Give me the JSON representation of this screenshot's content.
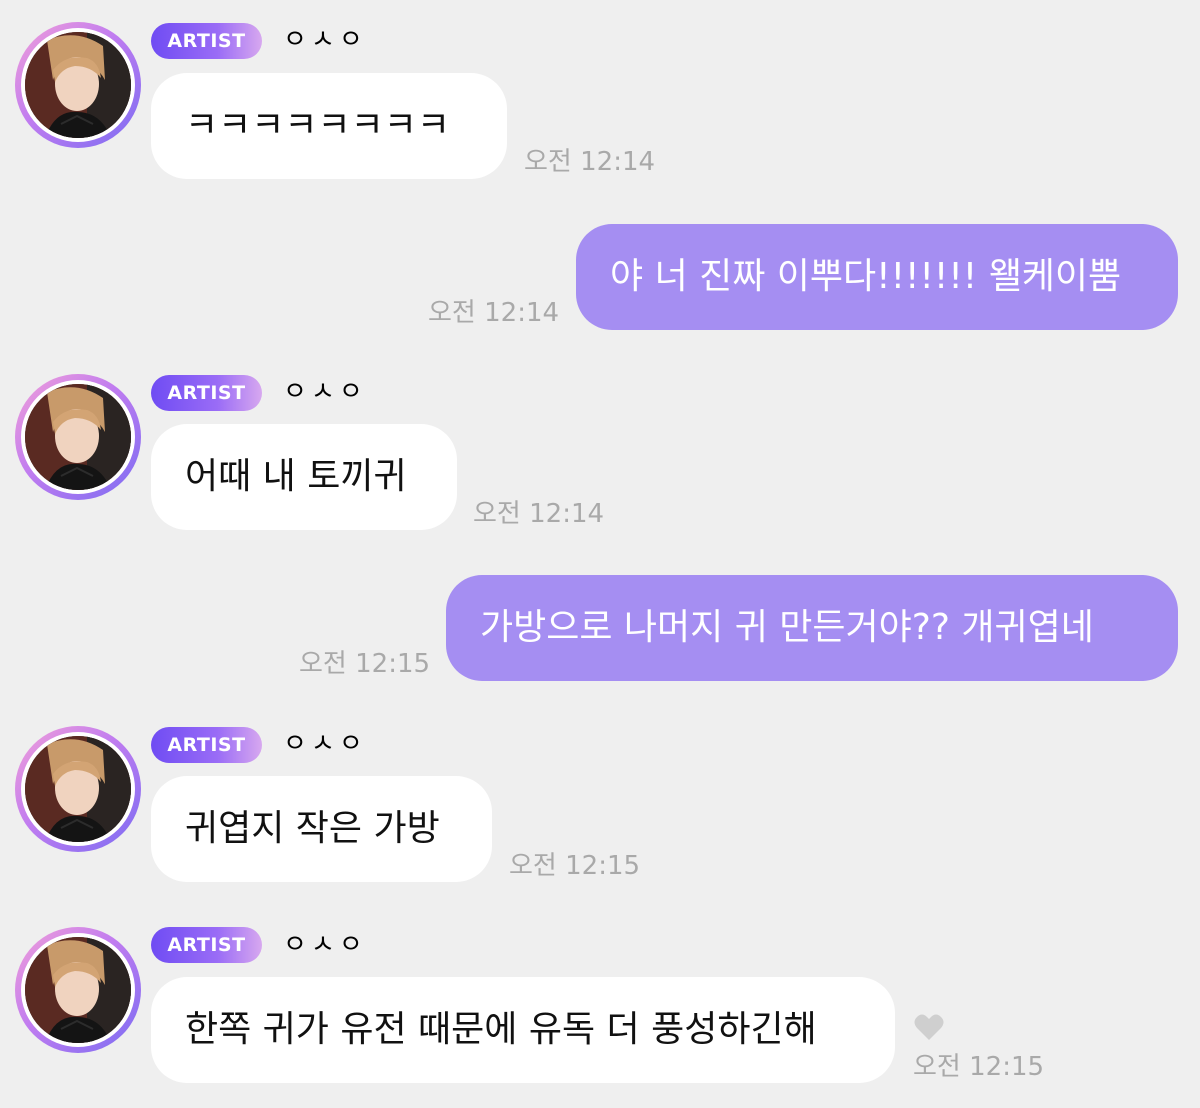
{
  "conversation": {
    "messages": [
      {
        "type": "artist",
        "badge": "ARTIST",
        "name": "ㅇㅅㅇ",
        "text": "ㅋㅋㅋㅋㅋㅋㅋㅋ",
        "time": "오전 12:14"
      },
      {
        "type": "user",
        "text": "야 너 진짜 이뿌다!!!!!!! 왤케이뿜",
        "time": "오전 12:14"
      },
      {
        "type": "artist",
        "badge": "ARTIST",
        "name": "ㅇㅅㅇ",
        "text": "어때 내 토끼귀",
        "time": "오전 12:14"
      },
      {
        "type": "user",
        "text": "가방으로 나머지 귀 만든거야?? 개귀엽네",
        "time": "오전 12:15"
      },
      {
        "type": "artist",
        "badge": "ARTIST",
        "name": "ㅇㅅㅇ",
        "text": "귀엽지 작은 가방",
        "time": "오전 12:15"
      },
      {
        "type": "artist",
        "badge": "ARTIST",
        "name": "ㅇㅅㅇ",
        "text": "한쪽 귀가 유전 때문에 유독 더 풍성하긴해",
        "time": "오전 12:15"
      }
    ]
  },
  "colors": {
    "background": "#efefef",
    "outgoing_bubble": "#a58ef2",
    "incoming_bubble": "#ffffff",
    "badge_start": "#6f4cf3",
    "timestamp": "#a9a9a9"
  },
  "icons": {
    "like": "heart-icon"
  }
}
